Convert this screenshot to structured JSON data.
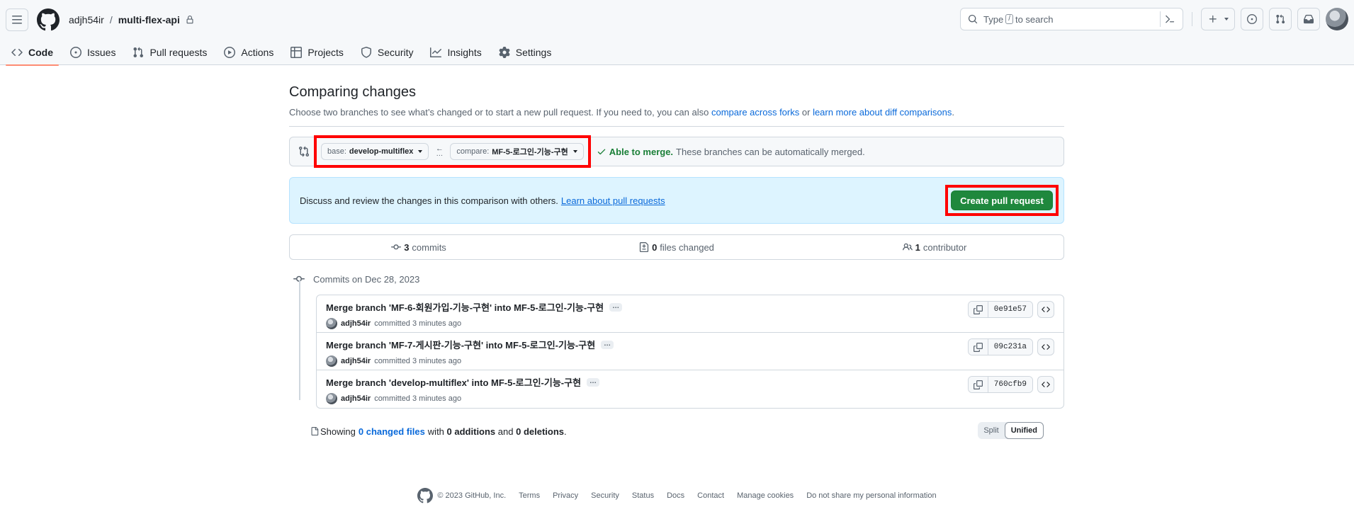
{
  "header": {
    "owner": "adjh54ir",
    "separator": "/",
    "repo": "multi-flex-api",
    "search_prefix": "Type",
    "search_key": "/",
    "search_suffix": "to search"
  },
  "nav": [
    {
      "label": "Code",
      "icon": "code-icon"
    },
    {
      "label": "Issues",
      "icon": "issue-icon"
    },
    {
      "label": "Pull requests",
      "icon": "pull-request-icon"
    },
    {
      "label": "Actions",
      "icon": "play-icon"
    },
    {
      "label": "Projects",
      "icon": "table-icon"
    },
    {
      "label": "Security",
      "icon": "shield-icon"
    },
    {
      "label": "Insights",
      "icon": "graph-icon"
    },
    {
      "label": "Settings",
      "icon": "gear-icon"
    }
  ],
  "compare": {
    "title": "Comparing changes",
    "subtitle_prefix": "Choose two branches to see what’s changed or to start a new pull request. If you need to, you can also",
    "link_forks": "compare across forks",
    "subtitle_or": "or",
    "link_learn_diff": "learn more about diff comparisons",
    "subtitle_end": ".",
    "base_label": "base:",
    "base_branch": "develop-multiflex",
    "compare_label": "compare:",
    "compare_branch": "MF-5-로그인-기능-구현",
    "merge_ok": "Able to merge.",
    "merge_text": "These branches can be automatically merged."
  },
  "discuss": {
    "text": "Discuss and review the changes in this comparison with others.",
    "link": "Learn about pull requests",
    "create_button": "Create pull request"
  },
  "stats": {
    "commits_count": "3",
    "commits_label": "commits",
    "files_count": "0",
    "files_label": "files changed",
    "contributors_count": "1",
    "contributors_label": "contributor"
  },
  "timeline": {
    "heading": "Commits on Dec 28, 2023",
    "commits": [
      {
        "title": "Merge branch 'MF-6-회원가입-기능-구현' into MF-5-로그인-기능-구현",
        "author": "adjh54ir",
        "time": "committed 3 minutes ago",
        "sha": "0e91e57"
      },
      {
        "title": "Merge branch 'MF-7-게시판-기능-구현' into MF-5-로그인-기능-구현",
        "author": "adjh54ir",
        "time": "committed 3 minutes ago",
        "sha": "09c231a"
      },
      {
        "title": "Merge branch 'develop-multiflex' into MF-5-로그인-기능-구현",
        "author": "adjh54ir",
        "time": "committed 3 minutes ago",
        "sha": "760cfb9"
      }
    ],
    "ellipsis": "…"
  },
  "summary": {
    "showing": "Showing",
    "changed_files": "0 changed files",
    "with": "with",
    "additions": "0 additions",
    "and": "and",
    "deletions": "0 deletions",
    "end": ".",
    "split": "Split",
    "unified": "Unified"
  },
  "footer": {
    "copyright": "© 2023 GitHub, Inc.",
    "links": [
      "Terms",
      "Privacy",
      "Security",
      "Status",
      "Docs",
      "Contact",
      "Manage cookies",
      "Do not share my personal information"
    ]
  },
  "colors": {
    "primary_button": "#1f883d",
    "link": "#0969da",
    "highlight_outline": "#ff0000",
    "active_tab_underline": "#fd8c73",
    "merge_ok": "#1a7f37"
  }
}
